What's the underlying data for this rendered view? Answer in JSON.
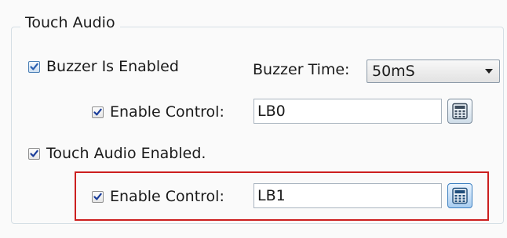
{
  "touch_audio": {
    "group_title": "Touch Audio",
    "buzzer_enabled": {
      "label": "Buzzer Is Enabled",
      "checked": true
    },
    "buzzer_time": {
      "label": "Buzzer Time:",
      "value": "50mS"
    },
    "buzzer_enable_control": {
      "label": "Enable Control:",
      "value": "LB0",
      "checked": true
    },
    "touch_audio_enabled": {
      "label": "Touch Audio Enabled.",
      "checked": true
    },
    "touch_enable_control": {
      "label": "Enable Control:",
      "value": "LB1",
      "checked": true
    }
  },
  "icons": {
    "check": "check-icon",
    "calculator": "calculator-icon",
    "dropdown": "chevron-down-icon"
  },
  "colors": {
    "highlight": "#cc1f1f",
    "checkmark": "#1a3d9a",
    "check_primary": "#2a5fb0"
  }
}
